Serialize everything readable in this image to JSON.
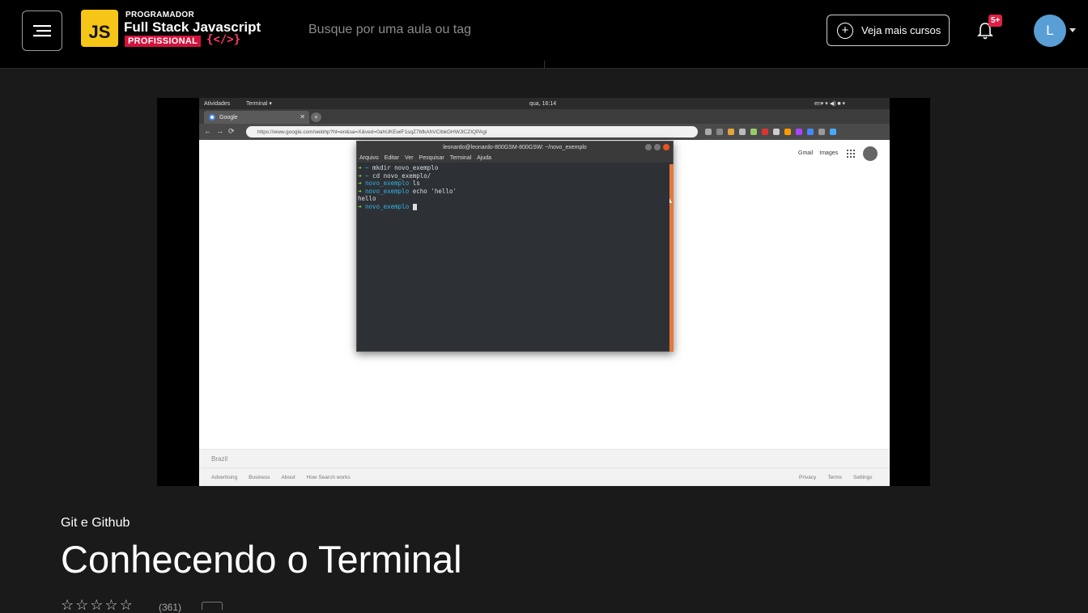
{
  "header": {
    "logo": {
      "js_text": "JS",
      "small_text": "PROGRAMADOR",
      "big_text": "Full Stack Javascript",
      "pro_text": "PROFISSIONAL",
      "brace_text": "{</>}"
    },
    "search_placeholder": "Busque por uma aula ou tag",
    "courses_button_label": "Veja mais cursos",
    "notifications_badge": "5+",
    "avatar_initial": "L",
    "icons": {
      "menu": "hamburger-menu-icon",
      "plus": "plus-circle-icon",
      "bell": "bell-icon",
      "caret": "chevron-down-icon"
    },
    "colors": {
      "badge": "#e02146",
      "avatar": "#5a9ed6",
      "logo_yellow": "#f5c518",
      "logo_red": "#d4123e"
    }
  },
  "video": {
    "ubuntu_bar": {
      "activities": "Atividades",
      "app": "Terminal ▾",
      "clock": "qua, 16:14",
      "right": "en▾  ▾ ◀) ■ ▾"
    },
    "browser": {
      "tab_title": "Google",
      "url": "https://www.google.com/webhp?hl=en&sa=X&ved=0ahUKEwiF1sqZ7bfkAhVCIbkGHWJlCZIQPAgI",
      "google_links": [
        "Gmail",
        "Images"
      ],
      "footer_country": "Brazil",
      "footer_left": [
        "Advertising",
        "Business",
        "About",
        "How Search works"
      ],
      "footer_right": [
        "Privacy",
        "Terms",
        "Settings"
      ]
    },
    "terminal": {
      "title": "leonardo@leonardo-800GSM-800GSW: ~/novo_exemplo",
      "menu": [
        "Arquivo",
        "Editar",
        "Ver",
        "Pesquisar",
        "Terminal",
        "Ajuda"
      ],
      "lines": [
        {
          "arrow": "➜",
          "dir": " ~",
          "cmd": " mkdir novo_exemplo"
        },
        {
          "arrow": "➜",
          "dir": " ~",
          "cmd": " cd novo_exemplo/"
        },
        {
          "arrow": "➜",
          "dir": " novo_exemplo",
          "cmd": " ls"
        },
        {
          "arrow": "➜",
          "dir": " novo_exemplo",
          "cmd": " echo 'hello'"
        },
        {
          "arrow": "",
          "dir": "",
          "cmd": "hello"
        },
        {
          "arrow": "➜",
          "dir": " novo_exemplo",
          "cmd": " "
        }
      ]
    }
  },
  "lesson": {
    "course_name": "Git e Github",
    "title": "Conhecendo o Terminal",
    "stars": [
      "☆",
      "☆",
      "☆",
      "☆",
      "☆"
    ],
    "rating_count": "(361)"
  }
}
